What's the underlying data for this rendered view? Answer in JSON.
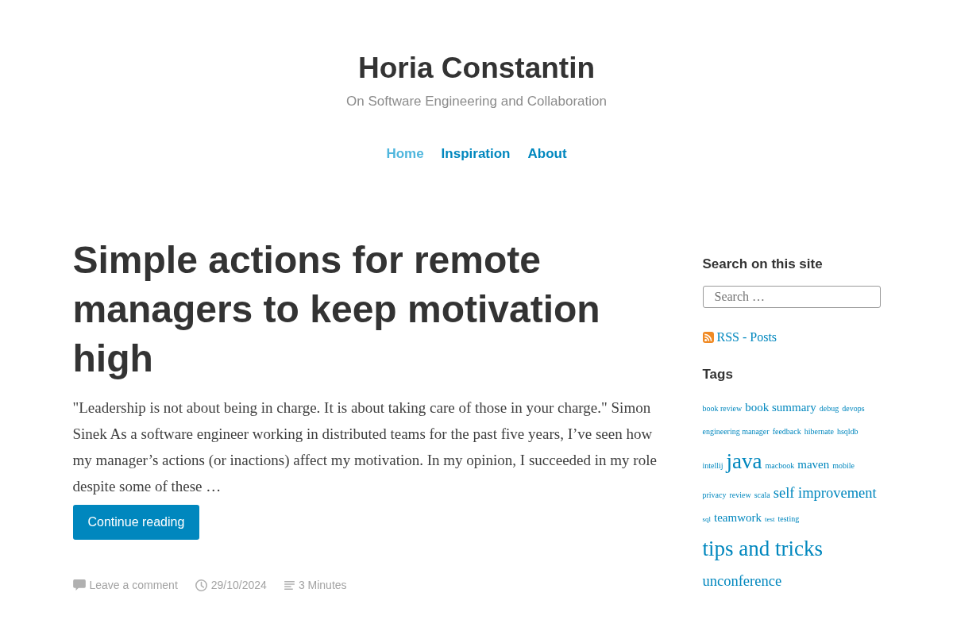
{
  "site": {
    "title": "Horia Constantin",
    "tagline": "On Software Engineering and Collaboration"
  },
  "nav": [
    {
      "label": "Home",
      "selected": true
    },
    {
      "label": "Inspiration",
      "selected": false
    },
    {
      "label": "About",
      "selected": false
    }
  ],
  "post": {
    "title": "Simple actions for remote managers to keep motivation high",
    "excerpt": "\"Leadership is not about being in charge. It is about taking care of those in your charge.\" Simon Sinek As a software engineer working in distributed teams for the past five years, I’ve seen how my manager’s actions (or inactions) affect my motivation. In my opinion, I succeeded in my role despite some of these …",
    "button": "Continue reading",
    "meta": [
      {
        "kind": "comments",
        "label": "Leave a comment"
      },
      {
        "kind": "date",
        "label": "29/10/2024"
      },
      {
        "kind": "reading_time",
        "label": "3 Minutes"
      }
    ]
  },
  "sidebar": {
    "search": {
      "heading": "Search on this site",
      "placeholder": "Search …"
    },
    "rss": {
      "label": "RSS - Posts"
    },
    "tags": {
      "heading": "Tags",
      "items": [
        {
          "label": "book review",
          "kind": "small"
        },
        {
          "label": "book summary",
          "kind": "medium"
        },
        {
          "label": "debug",
          "kind": "small"
        },
        {
          "label": "devops",
          "kind": "small"
        },
        {
          "label": "engineering manager",
          "kind": "small"
        },
        {
          "label": "feedback",
          "kind": "small"
        },
        {
          "label": "hibernate",
          "kind": "small"
        },
        {
          "label": "hsqldb",
          "kind": "small"
        },
        {
          "label": "intellij",
          "kind": "small"
        },
        {
          "label": "java",
          "kind": "largest"
        },
        {
          "label": "macbook",
          "kind": "small"
        },
        {
          "label": "maven",
          "kind": "medium"
        },
        {
          "label": "mobile",
          "kind": "small"
        },
        {
          "label": "privacy",
          "kind": "small"
        },
        {
          "label": "review",
          "kind": "small"
        },
        {
          "label": "scala",
          "kind": "small"
        },
        {
          "label": "self improvement",
          "kind": "large"
        },
        {
          "label": "sql",
          "kind": "smallest"
        },
        {
          "label": "teamwork",
          "kind": "medium"
        },
        {
          "label": "test",
          "kind": "smallest"
        },
        {
          "label": "testing",
          "kind": "small"
        },
        {
          "label": "tips and tricks",
          "kind": "largest"
        },
        {
          "label": "unconference",
          "kind": "large"
        }
      ]
    }
  }
}
